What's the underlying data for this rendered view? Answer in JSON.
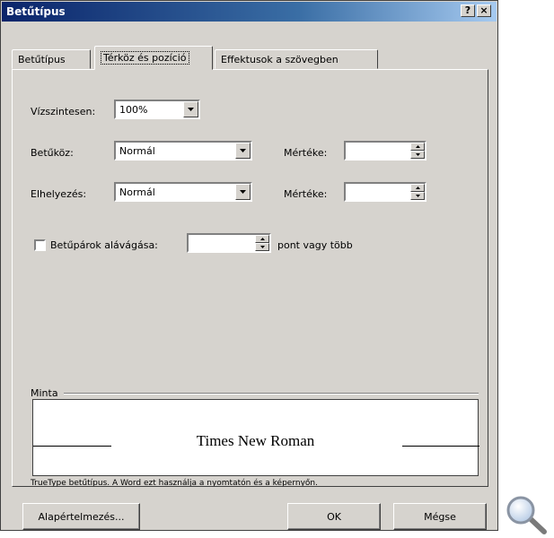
{
  "window": {
    "title": "Betűtípus",
    "help_label": "?",
    "close_label": "×"
  },
  "tabs": [
    {
      "label": "Betűtípus"
    },
    {
      "label": "Térköz és pozíció"
    },
    {
      "label": "Effektusok a szövegben"
    }
  ],
  "form": {
    "scale_label": "Vízszintesen:",
    "scale_value": "100%",
    "spacing_label": "Betűköz:",
    "spacing_value": "Normál",
    "spacing_by_label": "Mértéke:",
    "spacing_by_value": "",
    "position_label": "Elhelyezés:",
    "position_value": "Normál",
    "position_by_label": "Mértéke:",
    "position_by_value": "",
    "kerning_label": "Betűpárok alávágása:",
    "kerning_checked": false,
    "kerning_value": "",
    "kerning_suffix": "pont vagy több"
  },
  "preview": {
    "label": "Minta",
    "sample_text": "Times New Roman",
    "description": "TrueType betűtípus. A Word ezt használja a nyomtatón és a képernyőn."
  },
  "buttons": {
    "default_label": "Alapértelmezés...",
    "ok_label": "OK",
    "cancel_label": "Mégse"
  },
  "icons": {
    "magnifier": "magnifier-icon",
    "dropdown": "chevron-down-icon",
    "spin_up": "spin-up-icon",
    "spin_down": "spin-down-icon"
  },
  "colors": {
    "titlebar_start": "#0a246a",
    "titlebar_end": "#a6caf0",
    "face": "#d6d3ce"
  }
}
